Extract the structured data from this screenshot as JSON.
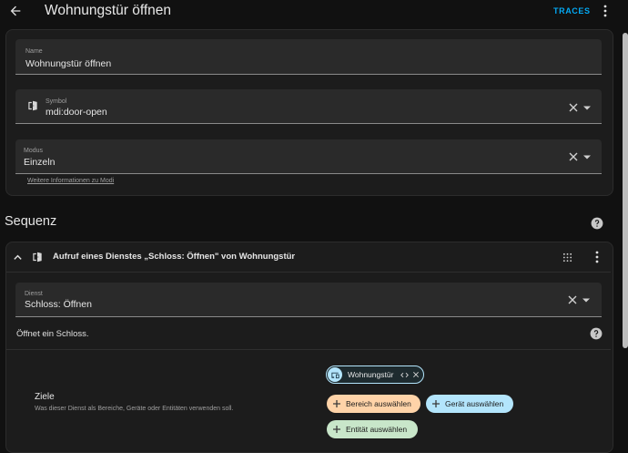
{
  "header": {
    "title": "Wohnungstür öffnen",
    "traces_label": "TRACES"
  },
  "settings": {
    "name_label": "Name",
    "name_value": "Wohnungstür öffnen",
    "symbol_label": "Symbol",
    "symbol_value": "mdi:door-open",
    "mode_label": "Modus",
    "mode_value": "Einzeln",
    "mode_info_link": "Weitere Informationen zu Modi"
  },
  "sequence": {
    "title": "Sequenz",
    "action_title": "Aufruf eines Dienstes „Schloss: Öffnen\" von Wohnungstür",
    "service_label": "Dienst",
    "service_value": "Schloss: Öffnen",
    "service_description": "Öffnet ein Schloss.",
    "targets_title": "Ziele",
    "targets_subtitle": "Was dieser Dienst als Bereiche, Geräte oder Entitäten verwenden soll.",
    "chips": {
      "entity": "Wohnungstür",
      "area": "Bereich auswählen",
      "device": "Gerät auswählen",
      "entity_select": "Entität auswählen"
    }
  },
  "colors": {
    "accent": "#03a9f4",
    "area_chip": "#ffd3a8",
    "device_chip": "#b3e5fc",
    "entity_chip": "#c8e6c9"
  },
  "icons": [
    "back-arrow-icon",
    "more-vert-icon",
    "door-open-icon",
    "close-icon",
    "dropdown-icon",
    "help-icon",
    "chevron-up-icon",
    "drag-handle-icon",
    "devices-icon",
    "code-icon",
    "plus-icon"
  ]
}
